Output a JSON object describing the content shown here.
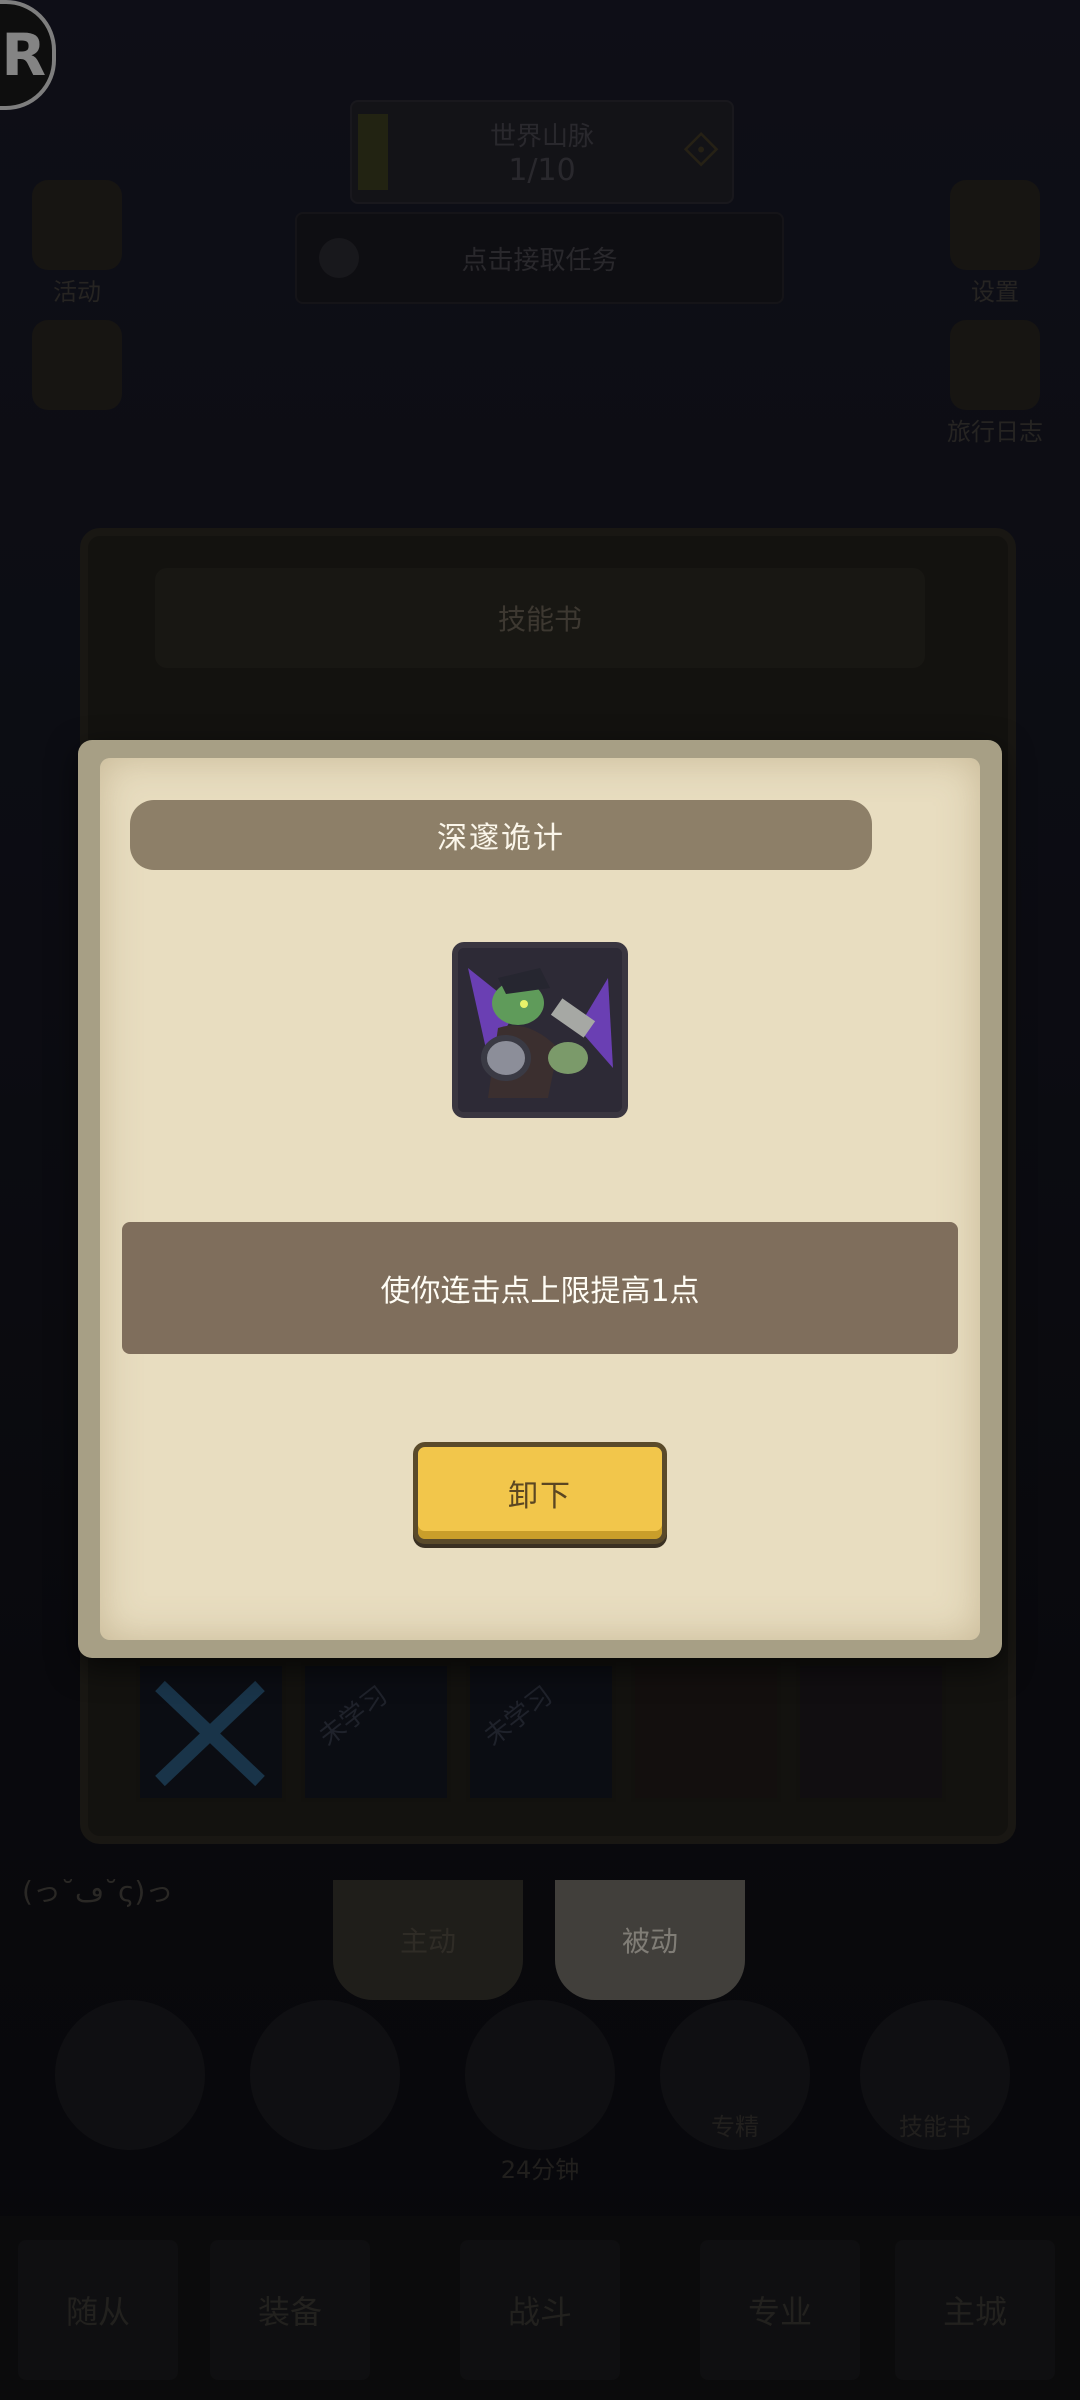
{
  "hud": {
    "record_label": "R",
    "world_title": "世界山脉",
    "world_progress": "1/10",
    "task_label": "点击接取任务",
    "left_icon_1": "活动",
    "right_icon_1": "设置",
    "right_icon_2": "旅行日志"
  },
  "back_panel": {
    "title": "技能书",
    "slot_not_learned_1": "未学习",
    "slot_not_learned_2": "未学习",
    "tab_active": "主动",
    "tab_passive": "被动",
    "player_name": "(っ˘ڡ˘ς)っ"
  },
  "bottom": {
    "circle_4_label": "专精",
    "circle_5_label": "技能书",
    "timer": "24分钟",
    "nav_1": "随从",
    "nav_2": "装备",
    "nav_3": "战斗",
    "nav_4": "专业",
    "nav_5": "主城"
  },
  "modal": {
    "title": "深邃诡计",
    "icon_name": "goblin-rogue-icon",
    "description": "使你连击点上限提高1点",
    "button_label": "卸下"
  },
  "colors": {
    "parchment": "#e8ddc0",
    "banner": "#8d7f68",
    "desc_bar": "#7f6e5c",
    "button_yellow": "#f2c64b"
  }
}
